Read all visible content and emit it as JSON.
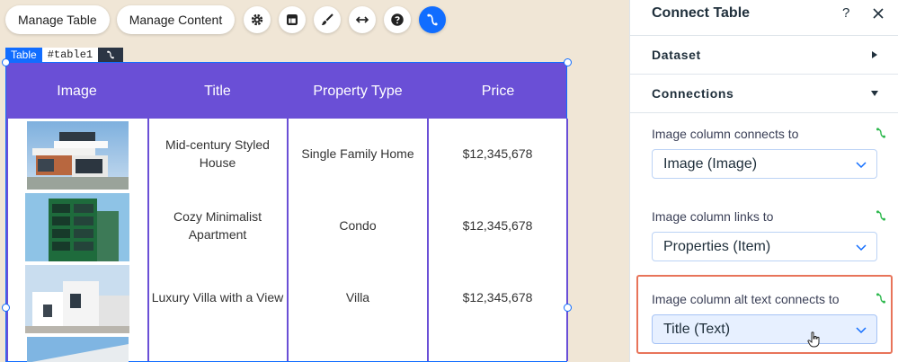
{
  "toolbar": {
    "manage_table_label": "Manage Table",
    "manage_content_label": "Manage Content",
    "icons": [
      "gear-icon",
      "layout-icon",
      "brush-icon",
      "stretch-icon",
      "help-icon",
      "connect-icon"
    ]
  },
  "table_tag": {
    "type": "Table",
    "id": "#table1"
  },
  "table": {
    "columns": [
      "Image",
      "Title",
      "Property Type",
      "Price"
    ],
    "rows": [
      {
        "image": "modern-house-image",
        "title": "Mid-century Styled House",
        "type": "Single Family Home",
        "price": "$12,345,678"
      },
      {
        "image": "green-tower-image",
        "title": "Cozy Minimalist Apartment",
        "type": "Condo",
        "price": "$12,345,678"
      },
      {
        "image": "white-villa-image",
        "title": "Luxury Villa with a View",
        "type": "Villa",
        "price": "$12,345,678"
      }
    ]
  },
  "panel": {
    "title": "Connect Table",
    "help": "?",
    "sections": {
      "dataset": "Dataset",
      "connections": "Connections"
    },
    "fields": [
      {
        "label": "Image column connects to",
        "value": "Image (Image)"
      },
      {
        "label": "Image column links to",
        "value": "Properties (Item)"
      },
      {
        "label": "Image column alt text connects to",
        "value": "Title (Text)"
      }
    ]
  },
  "colors": {
    "accent": "#116dff",
    "header": "#6a4fd6",
    "highlight": "#e8745a"
  }
}
